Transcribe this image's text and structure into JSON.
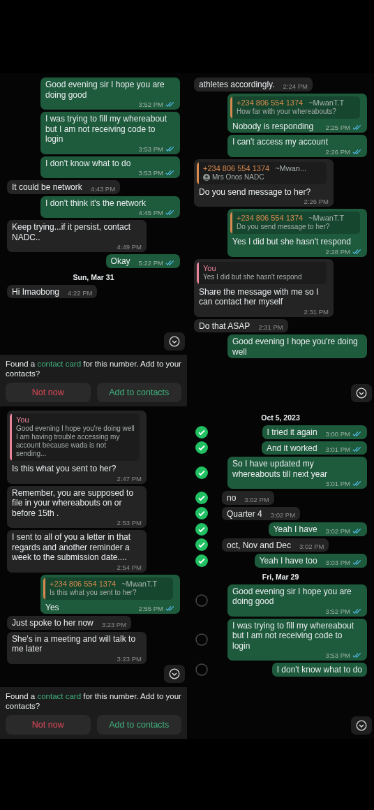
{
  "panels": [
    {
      "scroll_button": true,
      "items": [
        {
          "kind": "out",
          "text": "Good evening sir I hope you are doing good",
          "time": "3:52 PM",
          "read": true
        },
        {
          "kind": "out",
          "text": "I was trying to fill my whereabout but I am not receiving code to login",
          "time": "3:53 PM",
          "read": true
        },
        {
          "kind": "out",
          "text": "I don't know what to do",
          "time": "3:53 PM",
          "read": true
        },
        {
          "kind": "in",
          "text": "It could be network",
          "time": "4:43 PM"
        },
        {
          "kind": "out",
          "text": "I don't think it's the network",
          "time": "4:45 PM",
          "read": true
        },
        {
          "kind": "in",
          "text": "Keep trying...if it persist, contact NADC..",
          "time": "4:49 PM"
        },
        {
          "kind": "out",
          "text": "Okay",
          "time": "5:22 PM",
          "read": true
        },
        {
          "kind": "date",
          "text": "Sun, Mar 31"
        },
        {
          "kind": "in",
          "text": "Hi Imaobong",
          "time": "4:22 PM"
        }
      ],
      "banner": {
        "before": "Found a ",
        "link": "contact card",
        "after": " for this number. Add to your contacts?",
        "buttons": [
          {
            "label": "Not now",
            "kind": "dismiss"
          },
          {
            "label": "Add to contacts",
            "kind": "confirm"
          }
        ]
      }
    },
    {
      "scroll_button": true,
      "items": [
        {
          "kind": "in",
          "text": "athletes accordingly.",
          "time": "2:24 PM"
        },
        {
          "kind": "out",
          "text": "Nobody is responding",
          "time": "2:25 PM",
          "read": true,
          "quote": {
            "author": "+234 806 554 1374",
            "suffix": "~MwanT.T",
            "text": "How far with your whereabouts?",
            "color": "#d8894f"
          }
        },
        {
          "kind": "out",
          "text": "I can't access my account",
          "time": "2:26 PM",
          "read": true
        },
        {
          "kind": "in",
          "text": "Do you send message to her?",
          "time": "2:26 PM",
          "quote": {
            "author": "+234 806 554 1374",
            "suffix": "~Mwan...",
            "text": "Mrs Onos NADC",
            "kind": "contact",
            "color": "#d8894f"
          }
        },
        {
          "kind": "out",
          "text": "Yes I did but she hasn't respond",
          "time": "2:28 PM",
          "read": true,
          "quote": {
            "author": "+234 806 554 1374",
            "suffix": "~MwanT.T",
            "text": "Do you send message to her?",
            "color": "#d8894f"
          }
        },
        {
          "kind": "in",
          "text": "Share the message with me so I can contact her myself",
          "time": "2:31 PM",
          "quote": {
            "author": "You",
            "text": "Yes I did but she hasn't respond",
            "color": "#e8839a"
          }
        },
        {
          "kind": "in",
          "text": "Do that ASAP",
          "time": "2:31 PM"
        },
        {
          "kind": "out",
          "text": "Good evening I hope you're doing well"
        }
      ]
    },
    {
      "scroll_button": true,
      "items": [
        {
          "kind": "in",
          "text": "Is this what you sent to her?",
          "time": "2:47 PM",
          "quote": {
            "author": "You",
            "text": "Good evening I hope you're doing well I am having trouble accessing my account because wada is not sending...",
            "color": "#e8839a"
          }
        },
        {
          "kind": "in",
          "text": "Remember, you are supposed to file in your whereabouts on or before 15th .",
          "time": "2:53 PM"
        },
        {
          "kind": "in",
          "text": "I sent to all of you a letter in that regards and another reminder a week to the submission date....",
          "time": "2:54 PM"
        },
        {
          "kind": "out",
          "text": "Yes",
          "time": "2:55 PM",
          "read": true,
          "quote": {
            "author": "+234 806 554 1374",
            "suffix": "~MwanT.T",
            "text": "Is this what you sent to her?",
            "color": "#d8894f"
          }
        },
        {
          "kind": "in",
          "text": "Just spoke to her now",
          "time": "3:23 PM"
        },
        {
          "kind": "in",
          "text": "She's in a meeting and will talk to me later",
          "time": "3:23 PM"
        }
      ],
      "banner": {
        "before": "Found a ",
        "link": "contact card",
        "after": " for this number. Add to your contacts?",
        "buttons": [
          {
            "label": "Not now",
            "kind": "dismiss"
          },
          {
            "label": "Add to contacts",
            "kind": "confirm"
          }
        ]
      }
    },
    {
      "scroll_button": true,
      "items": [
        {
          "kind": "date",
          "text": "Oct 5, 2023"
        },
        {
          "kind": "out",
          "text": "I tried it again",
          "time": "3:00 PM",
          "read": true,
          "selected": true
        },
        {
          "kind": "out",
          "text": "And it worked",
          "time": "3:01 PM",
          "read": true,
          "selected": true
        },
        {
          "kind": "out",
          "text": "So I have updated my whereabouts till next year",
          "time": "3:01 PM",
          "read": true,
          "selected": true
        },
        {
          "kind": "in",
          "text": "no",
          "time": "3:02 PM",
          "selected": true
        },
        {
          "kind": "in",
          "text": "Quarter 4",
          "time": "3:02 PM",
          "selected": true
        },
        {
          "kind": "out",
          "text": "Yeah I have",
          "time": "3:02 PM",
          "read": true,
          "selected": true
        },
        {
          "kind": "in",
          "text": "oct, Nov and Dec",
          "time": "3:02 PM",
          "selected": true
        },
        {
          "kind": "out",
          "text": "Yeah I have too",
          "time": "3:03 PM",
          "read": true,
          "selected": true
        },
        {
          "kind": "date",
          "text": "Fri, Mar 29"
        },
        {
          "kind": "out",
          "text": "Good evening sir I hope you are doing good",
          "time": "3:52 PM",
          "read": true,
          "selected": false
        },
        {
          "kind": "out",
          "text": "I was trying to fill my whereabout but I am not receiving code to login",
          "time": "3:53 PM",
          "read": true,
          "selected": false
        },
        {
          "kind": "out",
          "text": "I don't know what to do",
          "selected": false
        }
      ]
    }
  ]
}
